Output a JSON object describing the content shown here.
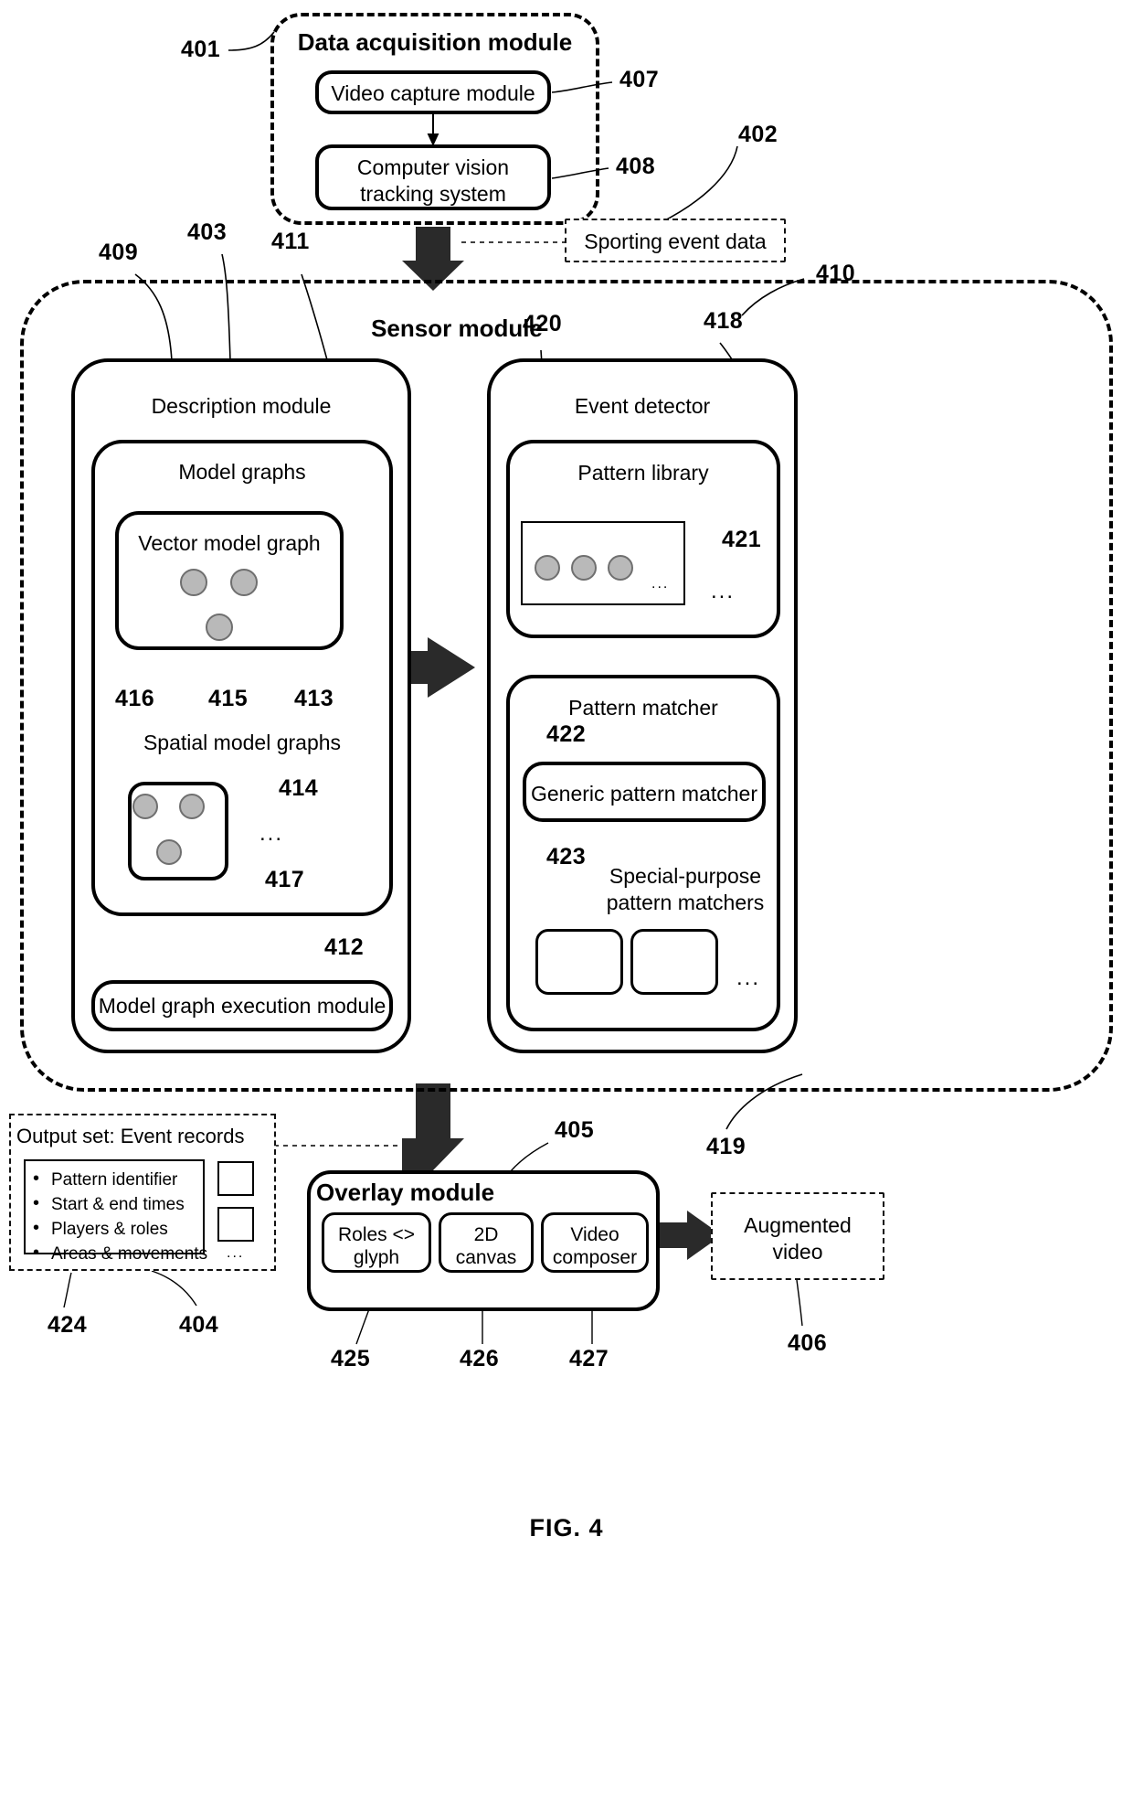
{
  "figure": {
    "caption": "FIG. 4"
  },
  "data_acquisition": {
    "title": "Data acquisition module",
    "ref": "401",
    "video_capture": {
      "label": "Video capture module",
      "ref": "407"
    },
    "cv_tracking": {
      "label": "Computer vision\ntracking system",
      "ref": "408"
    }
  },
  "sporting_event_data": {
    "label": "Sporting event data",
    "ref": "402"
  },
  "sensor_module": {
    "title": "Sensor module",
    "refs": {
      "outer": "403",
      "left_pointer": "409",
      "top_pointer": "411",
      "right_pointer": "410",
      "bottom_right_pointer": "419"
    }
  },
  "description_module": {
    "title": "Description module",
    "model_graphs": {
      "title": "Model graphs",
      "ref": "411",
      "vector_model_graph": {
        "title": "Vector model graph",
        "node_refs": [
          "416",
          "415",
          "413"
        ]
      },
      "spatial_model_graphs": {
        "title": "Spatial model graphs",
        "box_ref": "414",
        "edge_ref": "417",
        "ellipsis": "..."
      }
    },
    "execution_module": {
      "label": "Model graph execution module",
      "ref": "412"
    }
  },
  "event_detector": {
    "title": "Event detector",
    "refs": {
      "outer": "420",
      "inner": "418"
    },
    "pattern_library": {
      "title": "Pattern library",
      "item_ref": "421",
      "inner_ellipsis": "...",
      "outer_ellipsis": "..."
    },
    "pattern_matcher": {
      "title": "Pattern matcher",
      "generic": {
        "label": "Generic pattern matcher",
        "ref": "422"
      },
      "special": {
        "label": "Special-purpose\npattern matchers",
        "ref": "423",
        "ellipsis": "..."
      }
    }
  },
  "output_set": {
    "title": "Output set: Event records",
    "items": [
      "Pattern identifier",
      "Start & end times",
      "Players & roles",
      "Areas & movements"
    ],
    "ellipsis": "...",
    "refs": {
      "left": "424",
      "right": "404"
    }
  },
  "overlay_module": {
    "title": "Overlay module",
    "ref": "405",
    "blocks": [
      {
        "label": "Roles <>\nglyph",
        "ref": "425"
      },
      {
        "label": "2D\ncanvas",
        "ref": "426"
      },
      {
        "label": "Video\ncomposer",
        "ref": "427"
      }
    ]
  },
  "augmented_video": {
    "label": "Augmented\nvideo",
    "ref": "406"
  }
}
